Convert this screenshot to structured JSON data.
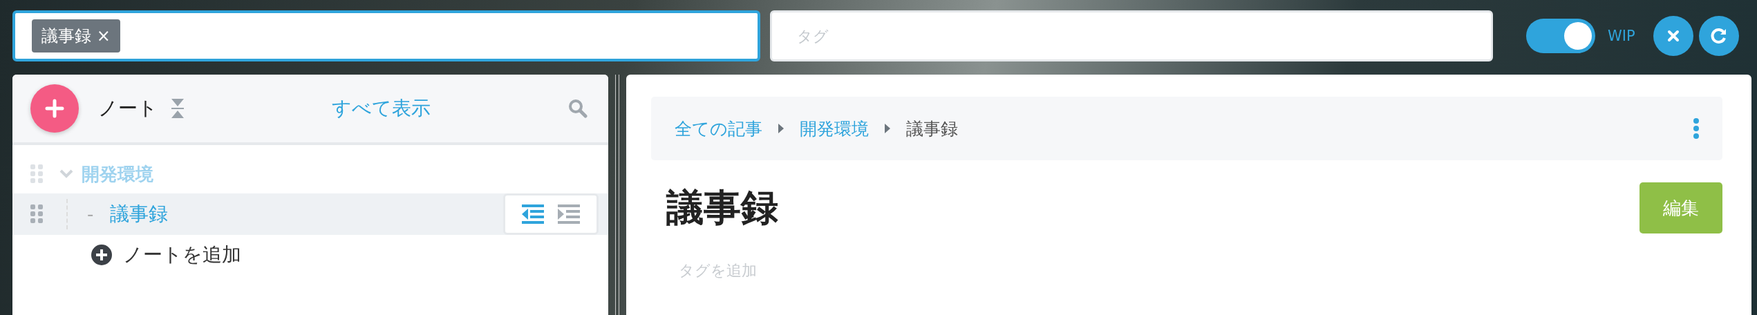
{
  "search": {
    "chips": [
      {
        "label": "議事録",
        "remove": "×"
      }
    ]
  },
  "tag_filter": {
    "placeholder": "タグ"
  },
  "wip_toggle": {
    "label": "WIP",
    "on": true
  },
  "sidebar": {
    "title": "ノート",
    "show_all": "すべて表示",
    "tree": [
      {
        "label": "開発環境",
        "expanded": true,
        "selected": false,
        "children": [
          {
            "label": "議事録",
            "bullet": "-",
            "selected": true
          }
        ]
      }
    ],
    "add_note": "ノートを追加"
  },
  "article": {
    "breadcrumb": [
      {
        "label": "全ての記事",
        "link": true
      },
      {
        "label": "開発環境",
        "link": true
      },
      {
        "label": "議事録",
        "link": false
      }
    ],
    "title": "議事録",
    "edit_button": "編集",
    "tag_placeholder": "タグを追加"
  }
}
